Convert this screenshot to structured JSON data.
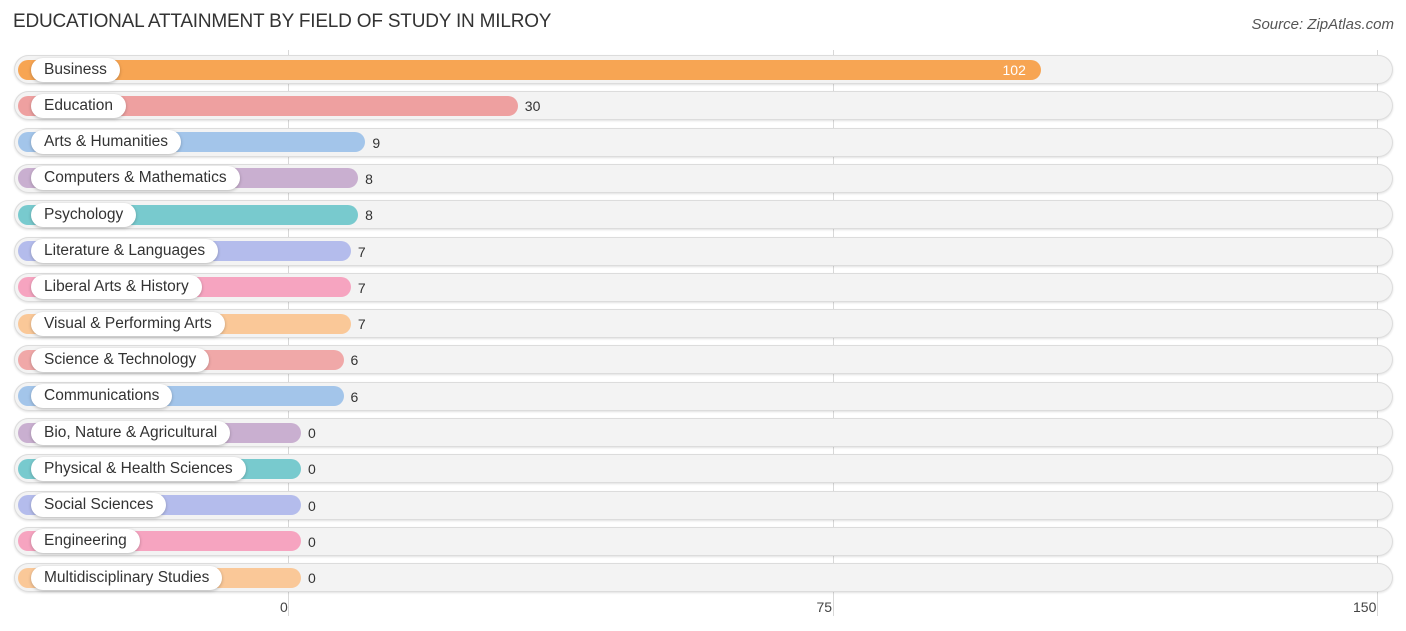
{
  "chart_data": {
    "type": "bar",
    "orientation": "horizontal",
    "title": "EDUCATIONAL ATTAINMENT BY FIELD OF STUDY IN MILROY",
    "source": "Source: ZipAtlas.com",
    "xlabel": "",
    "ylabel": "",
    "xlim": [
      0,
      150
    ],
    "xticks": [
      0,
      75,
      150
    ],
    "xtick_labels": [
      "0",
      "75",
      "150"
    ],
    "grid": true,
    "categories": [
      "Business",
      "Education",
      "Arts & Humanities",
      "Computers & Mathematics",
      "Psychology",
      "Literature & Languages",
      "Liberal Arts & History",
      "Visual & Performing Arts",
      "Science & Technology",
      "Communications",
      "Bio, Nature & Agricultural",
      "Physical & Health Sciences",
      "Social Sciences",
      "Engineering",
      "Multidisciplinary Studies"
    ],
    "values": [
      102,
      30,
      9,
      8,
      8,
      7,
      7,
      7,
      6,
      6,
      0,
      0,
      0,
      0,
      0
    ],
    "value_labels": [
      "102",
      "30",
      "9",
      "8",
      "8",
      "7",
      "7",
      "7",
      "6",
      "6",
      "0",
      "0",
      "0",
      "0",
      "0"
    ],
    "colors": [
      "#f7a553",
      "#eea0a0",
      "#a3c5ea",
      "#c9afd0",
      "#78cace",
      "#b4bcec",
      "#f6a4c0",
      "#fac898",
      "#f0a8a8",
      "#a3c5ea",
      "#c9afd0",
      "#78cace",
      "#b4bcec",
      "#f6a4c0",
      "#fac898"
    ]
  }
}
